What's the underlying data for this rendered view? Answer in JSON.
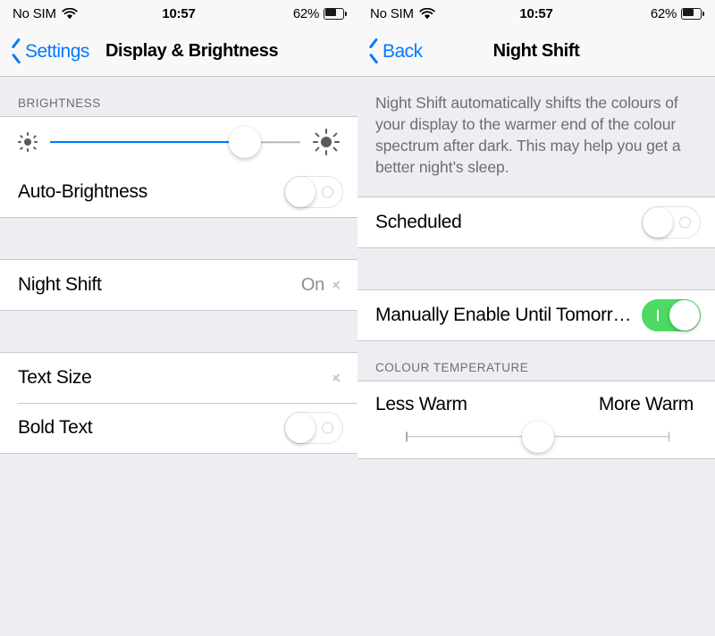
{
  "colors": {
    "accent_blue": "#007AFF",
    "toggle_on_green": "#4CD964",
    "background_gray": "#EEEEF2",
    "secondary_text": "#6D6D72"
  },
  "status_bar": {
    "carrier": "No SIM",
    "wifi_icon": "wifi-icon",
    "time": "10:57",
    "battery_percent": "62%",
    "battery_level": 62
  },
  "left_panel": {
    "nav": {
      "back_label": "Settings",
      "back_icon": "chevron-left-icon",
      "title": "Display & Brightness"
    },
    "brightness_section": {
      "header": "BRIGHTNESS",
      "slider": {
        "name": "brightness-slider",
        "value": 78,
        "low_icon": "sun-low-icon",
        "high_icon": "sun-high-icon"
      },
      "auto_brightness": {
        "label": "Auto-Brightness",
        "toggle_state": "off"
      }
    },
    "night_shift_row": {
      "label": "Night Shift",
      "value": "On",
      "accessory": "chevron-right-icon"
    },
    "text_section": {
      "text_size": {
        "label": "Text Size",
        "accessory": "chevron-right-icon"
      },
      "bold_text": {
        "label": "Bold Text",
        "toggle_state": "off"
      }
    }
  },
  "right_panel": {
    "nav": {
      "back_label": "Back",
      "back_icon": "chevron-left-icon",
      "title": "Night Shift"
    },
    "description": "Night Shift automatically shifts the colours of your display to the warmer end of the colour spectrum after dark. This may help you get a better night’s sleep.",
    "scheduled_row": {
      "label": "Scheduled",
      "toggle_state": "off"
    },
    "manual_row": {
      "label": "Manually Enable Until Tomorr…",
      "toggle_state": "on"
    },
    "colour_temperature": {
      "header": "COLOUR TEMPERATURE",
      "min_label": "Less Warm",
      "max_label": "More Warm",
      "slider": {
        "name": "colour-temperature-slider",
        "value": 50
      }
    }
  }
}
